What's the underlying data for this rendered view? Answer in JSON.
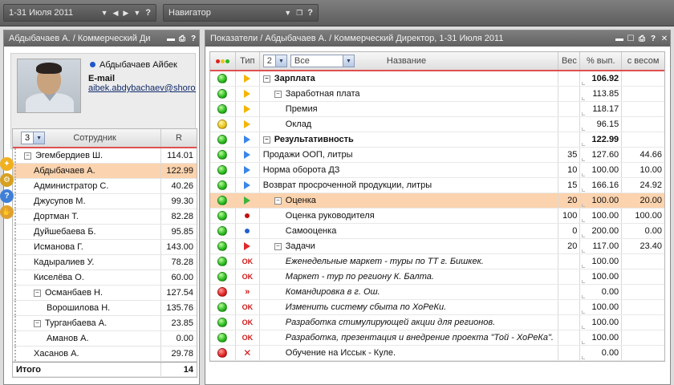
{
  "topbar": {
    "period": "1-31 Июля 2011",
    "navigator": "Навигатор"
  },
  "left_panel": {
    "title": "Абдыбачаев А. / Коммерческий Ди",
    "profile": {
      "name": "Абдыбачаев Айбек",
      "email_label": "E-mail",
      "email": "aibek.abdybachaev@shoro.kg"
    },
    "employees": {
      "level": "3",
      "col_name": "Сотрудник",
      "col_r": "R",
      "rows": [
        {
          "name": "Эгембердиев Ш.",
          "r": "114.01"
        },
        {
          "name": "Абдыбачаев А.",
          "r": "122.99"
        },
        {
          "name": "Администратор С.",
          "r": "40.26"
        },
        {
          "name": "Джусупов М.",
          "r": "99.30"
        },
        {
          "name": "Дортман Т.",
          "r": "82.28"
        },
        {
          "name": "Дуйшебаева Б.",
          "r": "95.85"
        },
        {
          "name": "Исманова Г.",
          "r": "143.00"
        },
        {
          "name": "Кадыралиев У.",
          "r": "78.28"
        },
        {
          "name": "Киселёва О.",
          "r": "60.00"
        },
        {
          "name": "Османбаев Н.",
          "r": "127.54"
        },
        {
          "name": "Ворошилова Н.",
          "r": "135.76"
        },
        {
          "name": "Турганбаева А.",
          "r": "23.85"
        },
        {
          "name": "Аманов А.",
          "r": "0.00"
        },
        {
          "name": "Хасанов А.",
          "r": "29.78"
        }
      ],
      "total_label": "Итого",
      "total_value": "14"
    }
  },
  "right_panel": {
    "title": "Показатели / Абдыбачаев А. / Коммерческий Директор, 1-31 Июля 2011",
    "header": {
      "type": "Тип",
      "level": "2",
      "filter": "Все",
      "name": "Название",
      "weight": "Вес",
      "percent": "% вып.",
      "with_weight": "с весом"
    },
    "rows": [
      {
        "status": "green",
        "type": "tri-yel",
        "name": "Зарплата",
        "w": "",
        "p": "106.92",
        "ww": ""
      },
      {
        "status": "green",
        "type": "tri-yel",
        "name": "Заработная плата",
        "w": "",
        "p": "113.85",
        "ww": ""
      },
      {
        "status": "green",
        "type": "tri-yel",
        "name": "Премия",
        "w": "",
        "p": "118.17",
        "ww": ""
      },
      {
        "status": "yellow",
        "type": "tri-yel",
        "name": "Оклад",
        "w": "",
        "p": "96.15",
        "ww": ""
      },
      {
        "status": "green",
        "type": "tri-blue",
        "name": "Результативность",
        "w": "",
        "p": "122.99",
        "ww": ""
      },
      {
        "status": "green",
        "type": "tri-blue",
        "name": "Продажи ООП, литры",
        "w": "35",
        "p": "127.60",
        "ww": "44.66"
      },
      {
        "status": "green",
        "type": "tri-blue",
        "name": "Норма оборота ДЗ",
        "w": "10",
        "p": "100.00",
        "ww": "10.00"
      },
      {
        "status": "green",
        "type": "tri-blue",
        "name": "Возврат просроченной продукции, литры",
        "w": "15",
        "p": "166.16",
        "ww": "24.92"
      },
      {
        "status": "green",
        "type": "tri-green",
        "name": "Оценка",
        "w": "20",
        "p": "100.00",
        "ww": "20.00"
      },
      {
        "status": "green",
        "type": "dot-red",
        "name": "Оценка руководителя",
        "w": "100",
        "p": "100.00",
        "ww": "100.00"
      },
      {
        "status": "green",
        "type": "dot-blue",
        "name": "Самооценка",
        "w": "0",
        "p": "200.00",
        "ww": "0.00"
      },
      {
        "status": "green",
        "type": "tri-red",
        "name": "Задачи",
        "w": "20",
        "p": "117.00",
        "ww": "23.40"
      },
      {
        "status": "green",
        "type": "ok",
        "type_text": "OK",
        "name": "Еженедельные маркет - туры по ТТ г. Бишкек.",
        "w": "",
        "p": "100.00",
        "ww": ""
      },
      {
        "status": "green",
        "type": "ok",
        "type_text": "OK",
        "name": "Маркет - тур по региону К. Балта.",
        "w": "",
        "p": "100.00",
        "ww": ""
      },
      {
        "status": "red",
        "type": "raq",
        "type_text": "»",
        "name": "Командировка в г. Ош.",
        "w": "",
        "p": "0.00",
        "ww": ""
      },
      {
        "status": "green",
        "type": "ok",
        "type_text": "OK",
        "name": "Изменить систему сбыта по ХоРеКи.",
        "w": "",
        "p": "100.00",
        "ww": ""
      },
      {
        "status": "green",
        "type": "ok",
        "type_text": "OK",
        "name": "Разработка стимулирующей акции для регионов.",
        "w": "",
        "p": "100.00",
        "ww": ""
      },
      {
        "status": "green",
        "type": "ok",
        "type_text": "OK",
        "name": "Разработка, презентация и внедрение проекта \"Той - ХоРеКа\".",
        "w": "",
        "p": "100.00",
        "ww": ""
      },
      {
        "status": "red",
        "type": "x",
        "type_text": "✕",
        "name": "Обучение на Иссык - Куле.",
        "w": "",
        "p": "0.00",
        "ww": ""
      }
    ]
  }
}
